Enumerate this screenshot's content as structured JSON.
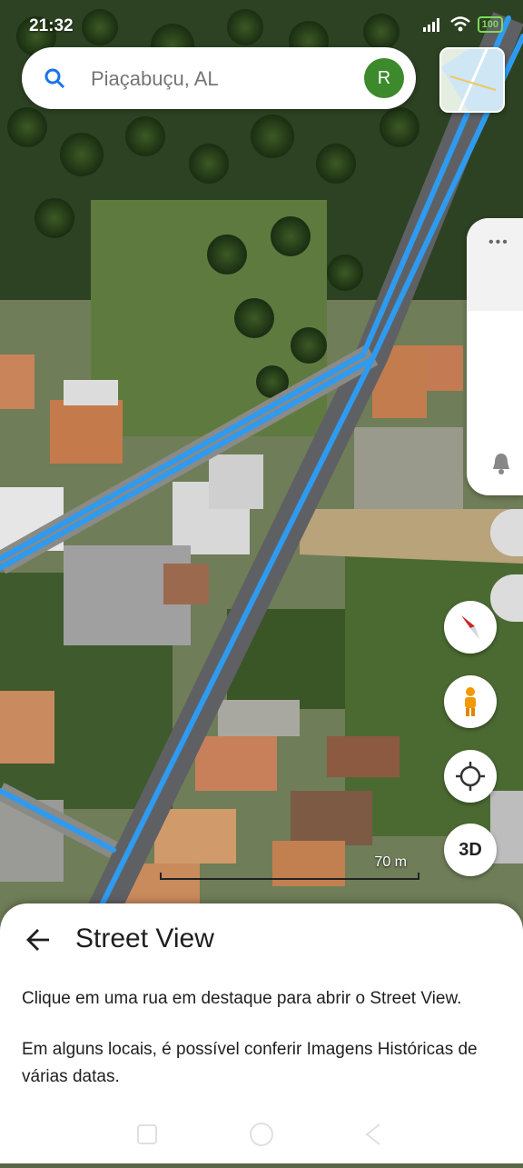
{
  "status_bar": {
    "time": "21:32",
    "battery": "100"
  },
  "search": {
    "placeholder": "Piaçabuçu, AL",
    "avatar_letter": "R"
  },
  "map": {
    "scale_label": "70 m",
    "street_highlight_color": "#2e9bf0"
  },
  "controls": {
    "btn_3d": "3D"
  },
  "street_view": {
    "title": "Street View",
    "instruction": "Clique em uma rua em destaque para abrir o Street View.",
    "historical": "Em alguns locais, é possível conferir Imagens Históricas de várias datas."
  }
}
